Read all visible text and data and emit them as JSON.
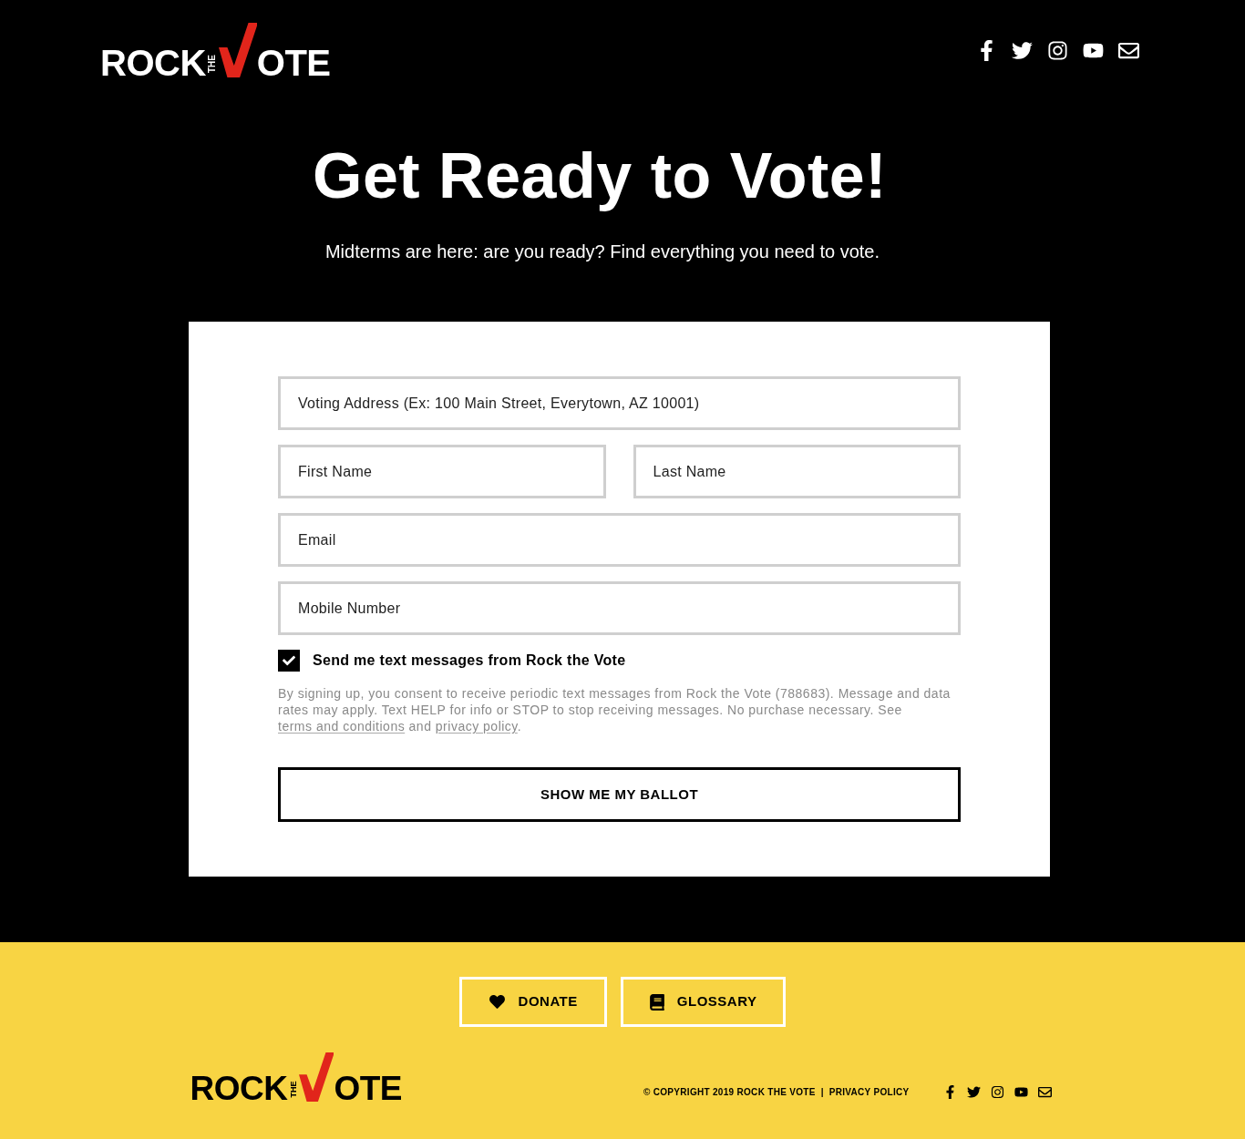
{
  "header": {
    "logo": {
      "word_1": "ROCK",
      "small_word": "THE",
      "word_2": "OTE"
    }
  },
  "hero": {
    "title": "Get Ready to Vote!",
    "subtitle": "Midterms are here: are you ready? Find everything you need to vote."
  },
  "form": {
    "rows": [
      {
        "fields": [
          {
            "placeholder": "Voting Address (Ex: 100 Main Street, Everytown, AZ 10001)"
          }
        ]
      },
      {
        "fields": [
          {
            "placeholder": "First Name"
          },
          {
            "placeholder": "Last Name"
          }
        ]
      },
      {
        "fields": [
          {
            "placeholder": "Email"
          }
        ]
      },
      {
        "fields": [
          {
            "placeholder": "Mobile Number"
          }
        ]
      }
    ],
    "sms_opt_in": {
      "label": "Send me text messages from Rock the Vote",
      "checked": true
    },
    "consent": [
      {
        "kind": "text",
        "text": "By signing up, you consent to receive periodic text messages from Rock the Vote (788683). Message and data rates may apply. Text HELP for info or STOP to stop receiving messages. No purchase necessary. See "
      },
      {
        "kind": "link",
        "text": "terms and conditions"
      },
      {
        "kind": "text",
        "text": " and "
      },
      {
        "kind": "link",
        "text": "privacy policy"
      },
      {
        "kind": "text",
        "text": "."
      }
    ],
    "submit_button": "SHOW ME MY BALLOT"
  },
  "footer": {
    "buttons": [
      {
        "kind": "donate",
        "label": "DONATE"
      },
      {
        "kind": "glossary",
        "label": "GLOSSARY"
      }
    ],
    "logo": {
      "word_1": "ROCK",
      "small_word": "THE",
      "word_2": "OTE"
    },
    "copyright": "© COPYRIGHT 2019 ROCK THE VOTE",
    "separator": "|",
    "privacy_link": "PRIVACY POLICY"
  }
}
